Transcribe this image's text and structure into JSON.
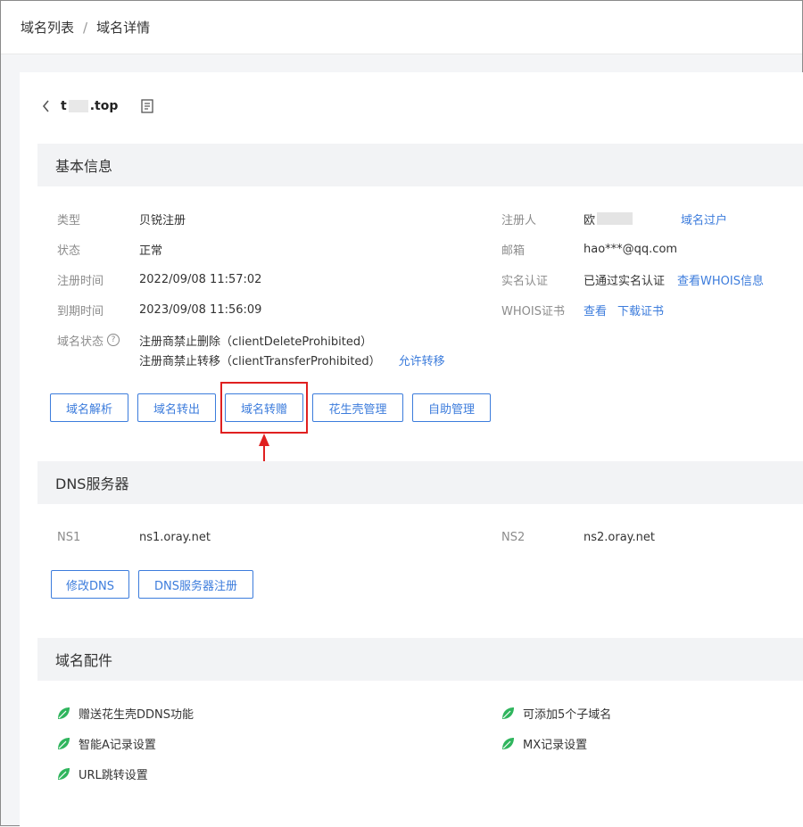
{
  "breadcrumb": {
    "item1": "域名列表",
    "separator": "/",
    "item2": "域名详情"
  },
  "domain": {
    "prefix": "t",
    "suffix": ".top"
  },
  "basic": {
    "title": "基本信息",
    "type_label": "类型",
    "type_value": "贝锐注册",
    "status_label": "状态",
    "status_value": "正常",
    "reg_time_label": "注册时间",
    "reg_time_value": "2022/09/08 11:57:02",
    "exp_time_label": "到期时间",
    "exp_time_value": "2023/09/08 11:56:09",
    "domain_status_label": "域名状态",
    "domain_status_1": "注册商禁止删除（clientDeleteProhibited）",
    "domain_status_2": "注册商禁止转移（clientTransferProhibited）",
    "allow_transfer": "允许转移",
    "registrant_label": "注册人",
    "registrant_value": "欧",
    "transfer_owner": "域名过户",
    "email_label": "邮箱",
    "email_value": "hao***@qq.com",
    "realname_label": "实名认证",
    "realname_value": "已通过实名认证",
    "whois_info": "查看WHOIS信息",
    "whois_cert_label": "WHOIS证书",
    "whois_view": "查看",
    "whois_download": "下载证书"
  },
  "actions": [
    "域名解析",
    "域名转出",
    "域名转赠",
    "花生壳管理",
    "自助管理"
  ],
  "dns": {
    "title": "DNS服务器",
    "ns1_label": "NS1",
    "ns1_value": "ns1.oray.net",
    "ns2_label": "NS2",
    "ns2_value": "ns2.oray.net",
    "modify_button": "修改DNS",
    "register_button": "DNS服务器注册"
  },
  "addons": {
    "title": "域名配件",
    "items": [
      "赠送花生壳DDNS功能",
      "可添加5个子域名",
      "智能A记录设置",
      "MX记录设置",
      "URL跳转设置"
    ]
  },
  "colors": {
    "accent": "#3c7cdc",
    "highlight": "#e02020",
    "leaf": "#2fb55d"
  }
}
